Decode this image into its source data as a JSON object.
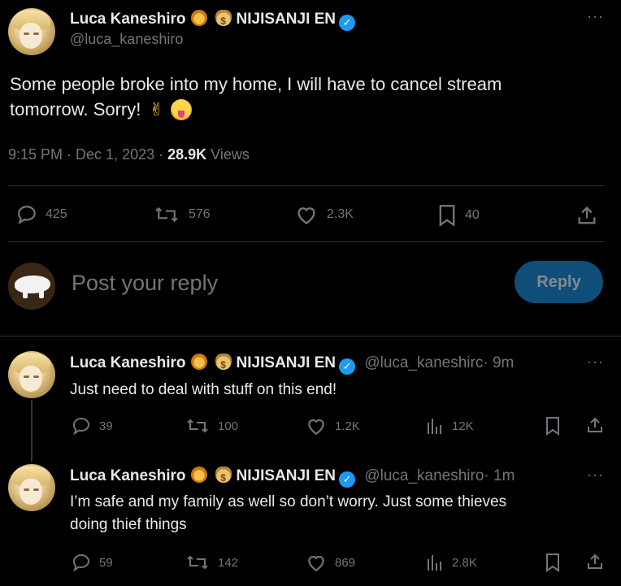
{
  "main_tweet": {
    "display_name": "Luca Kaneshiro",
    "affiliation": "NIJISANJI EN",
    "handle": "@luca_kaneshiro",
    "text": "Some people broke into my home, I will have to cancel stream tomorrow. Sorry!",
    "text_line1": "Some people broke into my home, I will have to cancel stream",
    "text_line2": "tomorrow. Sorry!",
    "timestamp": "9:15 PM · Dec 1, 2023 · ",
    "views_count": "28.9K",
    "views_label": " Views",
    "reply_count": "425",
    "retweet_count": "576",
    "like_count": "2.3K",
    "bookmark_count": "40",
    "emoji_icons": [
      "victory-hand-icon",
      "tongue-face-icon"
    ]
  },
  "reply_composer": {
    "placeholder": "Post your reply",
    "reply_button": "Reply"
  },
  "replies": [
    {
      "display_name": "Luca Kaneshiro",
      "affiliation": "NIJISANJI EN",
      "handle": "@luca_kaneshirc",
      "time": "· 9m",
      "text_line1": "Just need to deal with stuff on this end!",
      "text_line2": "",
      "reply_count": "39",
      "retweet_count": "100",
      "like_count": "1.2K",
      "view_count": "12K"
    },
    {
      "display_name": "Luca Kaneshiro",
      "affiliation": "NIJISANJI EN",
      "handle": "@luca_kaneshiro",
      "time": "· 1m",
      "text_line1": "I’m safe and my family as well so don’t worry. Just some thieves",
      "text_line2": "doing thief things",
      "reply_count": "59",
      "retweet_count": "142",
      "like_count": "869",
      "view_count": "2.8K"
    }
  ],
  "icons": {
    "verified": "verified-badge-icon",
    "lion": "lion-emoji-icon",
    "moneybag": "money-bag-emoji-icon"
  },
  "colors": {
    "background": "#000000",
    "text": "#e7e9ea",
    "muted": "#71767b",
    "accent": "#1d9bf0",
    "reply_button": "#0f4e78"
  }
}
